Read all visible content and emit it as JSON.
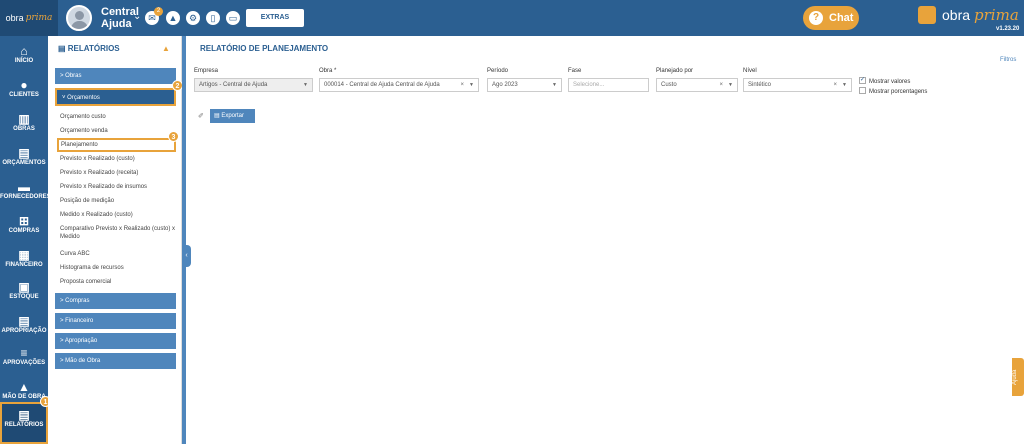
{
  "topbar": {
    "logo_left": "obra",
    "logo_right": "prima",
    "user": [
      "Central",
      "Ajuda"
    ],
    "badge": "2",
    "extras": "EXTRAS",
    "chat": "Chat",
    "brand_left": "obra",
    "brand_right": "prima",
    "version": "v1.23.20"
  },
  "nav": [
    {
      "label": "INÍCIO",
      "icon": "⌂"
    },
    {
      "label": "CLIENTES",
      "icon": "👤"
    },
    {
      "label": "OBRAS",
      "icon": "▥"
    },
    {
      "label": "ORÇAMENTOS",
      "icon": "▤"
    },
    {
      "label": "FORNECEDORES",
      "icon": "▬"
    },
    {
      "label": "COMPRAS",
      "icon": "⊞"
    },
    {
      "label": "FINANCEIRO",
      "icon": "▦"
    },
    {
      "label": "ESTOQUE",
      "icon": "▣"
    },
    {
      "label": "APROPRIAÇÃO",
      "icon": "▤"
    },
    {
      "label": "APROVAÇÕES",
      "icon": "≡"
    },
    {
      "label": "MÃO DE OBRA",
      "icon": "▲"
    },
    {
      "label": "RELATÓRIOS",
      "icon": "▤"
    }
  ],
  "steps": [
    "1",
    "2",
    "3"
  ],
  "panel": {
    "title": "RELATÓRIOS",
    "sections": [
      "> Obras",
      "˅ Orçamentos",
      "> Compras",
      "> Financeiro",
      "> Apropriação",
      "> Mão de Obra"
    ],
    "items": [
      "Orçamento custo",
      "Orçamento venda",
      "Planejamento",
      "Previsto x Realizado (custo)",
      "Previsto x Realizado (receita)",
      "Previsto x Realizado de insumos",
      "Posição de medição",
      "Medido x Realizado (custo)",
      "Comparativo Previsto x Realizado (custo) x Medido",
      "Curva ABC",
      "Histograma de recursos",
      "Proposta comercial"
    ]
  },
  "main": {
    "title": "RELATÓRIO DE PLANEJAMENTO",
    "filtros": "Filtros",
    "labels": [
      "Empresa",
      "Obra *",
      "Período",
      "Fase",
      "Planejado por",
      "Nível"
    ],
    "values": [
      "Artigos - Central de Ajuda",
      "000014 - Central de Ajuda Central de Ajuda",
      "Ago 2023",
      "Selecione...",
      "Custo",
      "Sintético"
    ],
    "mostrar_valores": "Mostrar valores",
    "mostrar_porcentagens": "Mostrar porcentagens",
    "exportar": "Exportar",
    "ajuda": "Ajuda"
  },
  "colors": {
    "primary": "#2b5f91",
    "accent": "#e8a33b",
    "section": "#4f86bc"
  }
}
